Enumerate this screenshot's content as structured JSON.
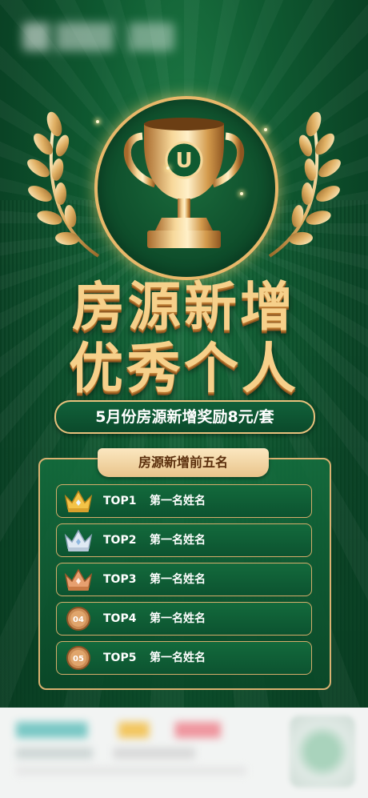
{
  "title": {
    "line1": "房源新增",
    "line2": "优秀个人"
  },
  "subtitle": "5月份房源新增奖励8元/套",
  "trophy_letter": "U",
  "panel": {
    "heading": "房源新增前五名",
    "rows": [
      {
        "rank": "TOP1",
        "name": "第一名姓名",
        "icon": "gold-crown-icon"
      },
      {
        "rank": "TOP2",
        "name": "第一名姓名",
        "icon": "silver-crown-icon"
      },
      {
        "rank": "TOP3",
        "name": "第一名姓名",
        "icon": "bronze-crown-icon"
      },
      {
        "rank": "TOP4",
        "name": "第一名姓名",
        "icon": "medal-04-icon",
        "badge": "04"
      },
      {
        "rank": "TOP5",
        "name": "第一名姓名",
        "icon": "medal-05-icon",
        "badge": "05"
      }
    ]
  },
  "colors": {
    "background": "#0f5a31",
    "gold": "#f6d08a",
    "border_gold": "#d9b171",
    "tab": "#e9c48b"
  }
}
